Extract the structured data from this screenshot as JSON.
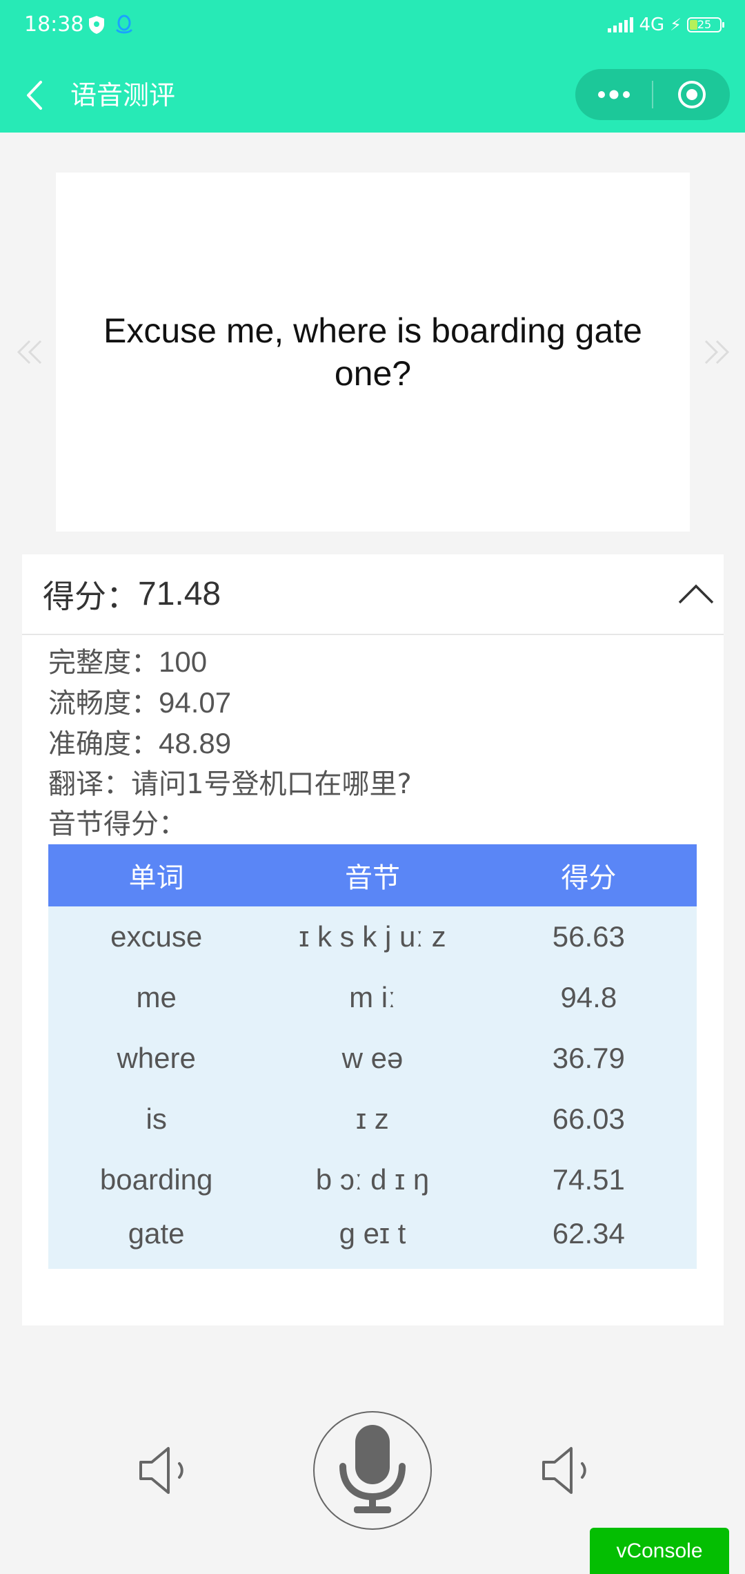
{
  "status_bar": {
    "time": "18:38",
    "network": "4G",
    "battery_level": "25",
    "battery_fraction": 0.25
  },
  "nav": {
    "title": "语音测评"
  },
  "sentence": {
    "text": "Excuse me, where is boarding gate one?"
  },
  "score": {
    "label": "得分：",
    "value": "71.48",
    "details": [
      {
        "label": "完整度：",
        "value": "100"
      },
      {
        "label": "流畅度：",
        "value": "94.07"
      },
      {
        "label": "准确度：",
        "value": "48.89"
      },
      {
        "label": "翻译：",
        "value": "请问1号登机口在哪里?"
      }
    ],
    "syllable_title": "音节得分："
  },
  "syllable_table": {
    "headers": [
      "单词",
      "音节",
      "得分"
    ],
    "rows": [
      [
        "excuse",
        "ɪ k s k j uː z",
        "56.63"
      ],
      [
        "me",
        "m iː",
        "94.8"
      ],
      [
        "where",
        "w eə",
        "36.79"
      ],
      [
        "is",
        "ɪ z",
        "66.03"
      ],
      [
        "boarding",
        "b ɔː d ɪ ŋ",
        "74.51"
      ],
      [
        "gate",
        "g eɪ t",
        "62.34"
      ]
    ]
  },
  "footer": {
    "vconsole_label": "vConsole"
  },
  "colors": {
    "header_bg": "#27eab6",
    "table_header_bg": "#5a86f6",
    "table_row_bg": "#e4f2fa",
    "vconsole_bg": "#04be02"
  },
  "icons": {
    "back": "chevron-left-icon",
    "more": "more-dots-icon",
    "close": "target-close-icon",
    "prev": "double-chevron-left-icon",
    "next": "double-chevron-right-icon",
    "collapse": "chevron-up-icon",
    "speaker": "speaker-icon",
    "mic": "microphone-icon"
  }
}
